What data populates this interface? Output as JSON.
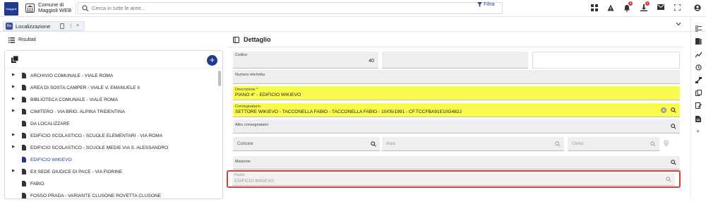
{
  "app": {
    "logo_text": "Maggioli",
    "org_name": "Comune di Maggioli WEB",
    "search_placeholder": "Cerca in tutte le aree...",
    "filter_label": "Filtra",
    "notifications_badge": "3",
    "downloads_badge": "1"
  },
  "tab": {
    "icon_text": "Re",
    "label": "Localizzazione"
  },
  "left": {
    "header_label": "Risultati",
    "items": [
      {
        "label": "ARCHIVIO COMUNALE - VIALE ROMA",
        "expandable": true
      },
      {
        "label": "AREA DI SOSTA CAMPER - VIALE V. EMANUELE II",
        "expandable": true
      },
      {
        "label": "BIBLIOTECA COMUNALE - VIALE ROMA",
        "expandable": true
      },
      {
        "label": "CIMITERO - VIA BRIG. ALPINA TRIDENTINA",
        "expandable": true
      },
      {
        "label": "DA LOCALIZZARE",
        "expandable": false
      },
      {
        "label": "EDIFICIO SCOLASTICO -  SCUOLE ELEMENTARI -  VIA ROMA",
        "expandable": true
      },
      {
        "label": "EDIFICIO SCOLASTICO - SCUOLE MEDIE VIA S. ALESSANDRO",
        "expandable": true
      },
      {
        "label": "EDIFICIO WIKIEVO",
        "expandable": false,
        "selected": true
      },
      {
        "label": "EX SEDE GIUDICE DI PACE - VIA FIORINE",
        "expandable": true
      },
      {
        "label": "FABIO",
        "expandable": false
      },
      {
        "label": "FOSSO PRADA - VARIANTE CLUSONE ROVETTA  CLUSONE",
        "expandable": false
      }
    ]
  },
  "detail": {
    "title": "Dettaglio",
    "codice_label": "Codice",
    "codice_value": "40",
    "numero_etichetta_label": "Numero etichetta",
    "descrizione_label": "Descrizione",
    "required_mark": "*",
    "descrizione_value": "PIANO 4° - EDIFICIO WIKIEVO",
    "consegnatario_label": "Consegnatario",
    "consegnatario_value": "SETTORE WIKIEVO - TACCONELLA FABIO - TACCONELLA FABIO - 10/05/1991 - CF.TCCFBA91E10G482J",
    "altro_consegnatario_label": "Altro consegnatario",
    "comune_label": "Comune",
    "area_label": "Area",
    "civico_label": "Civico",
    "missione_label": "Missione",
    "padre_label": "Padre",
    "padre_value": "EDIFICIO WIKIEVO"
  },
  "colors": {
    "brand": "#1f3b8f",
    "highlight": "#fafb4d",
    "outline": "#e0383b",
    "badge": "#d9342b"
  },
  "icons": [
    "search-icon",
    "filter-icon",
    "dashboard-icon",
    "warning-icon",
    "bell-icon",
    "download-icon",
    "mail-icon",
    "fullscreen-icon",
    "user-icon",
    "list-icon",
    "copy-icon",
    "plus-icon",
    "clear-icon",
    "map-pin-icon",
    "chevron-down-icon"
  ]
}
